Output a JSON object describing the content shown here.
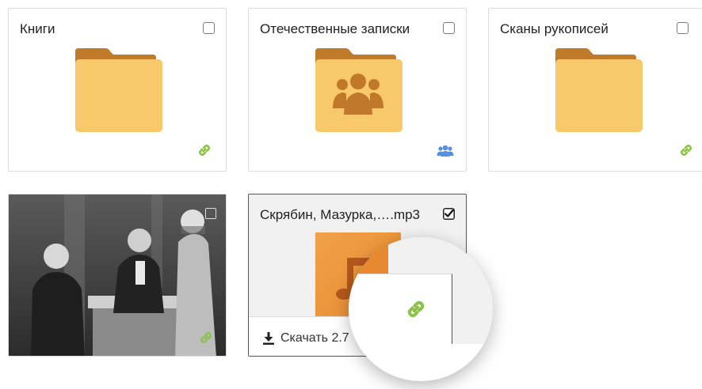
{
  "cards": [
    {
      "title": "Книги",
      "type": "folder",
      "badge": "link-icon"
    },
    {
      "title": "Отечественные записки",
      "type": "shared-folder",
      "badge": "shared-users-icon"
    },
    {
      "title": "Сканы рукописей",
      "type": "folder",
      "badge": "link-icon"
    }
  ],
  "mp3": {
    "title": "Скрябин, Мазурка,….mp3",
    "download_label": "Скачать 2.7",
    "checked": true,
    "badge": "link-icon"
  },
  "photo": {
    "badge": "link-icon"
  },
  "colors": {
    "folder_body": "#f8c96a",
    "folder_tab": "#bf7a2a",
    "shared_people": "#c0782b",
    "link_green": "#8bc34a",
    "shared_blue": "#5b8ee0",
    "mp3_orange": "#e8892f"
  }
}
